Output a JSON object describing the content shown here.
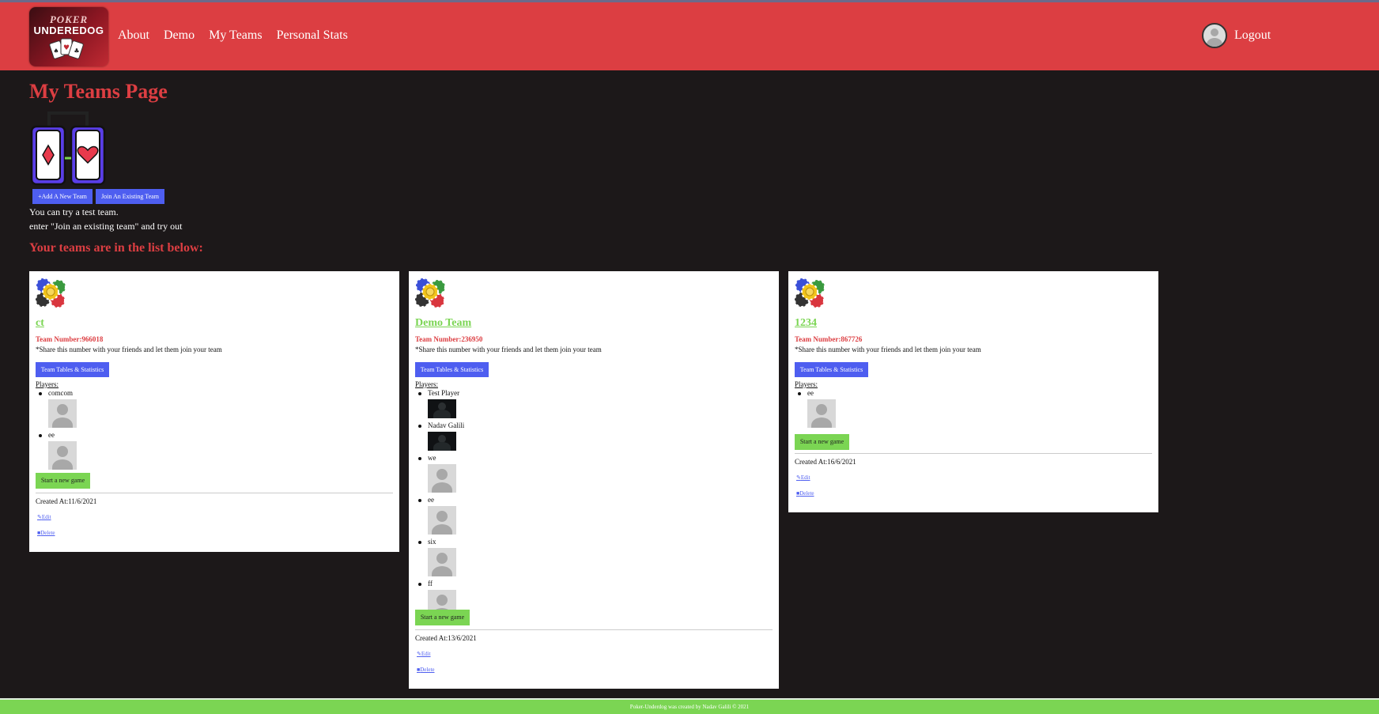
{
  "nav": {
    "logo_line1": "POKER",
    "logo_line2": "UNDEREDOG",
    "links": [
      "About",
      "Demo",
      "My Teams",
      "Personal Stats"
    ],
    "logout": "Logout"
  },
  "page": {
    "title": "My Teams Page",
    "add_team": "+Add A New Team",
    "join_team": "Join An Existing Team",
    "info_line1": "You can try a test team.",
    "info_line2": "enter \"Join an existing team\" and try out",
    "subtitle": "Your teams are in the list below:"
  },
  "common": {
    "share_text": "*Share this number with your friends and let them join your team",
    "stats_button": "Team Tables & Statistics",
    "players_label": "Players:",
    "start_game": "Start a new game",
    "edit": "Edit",
    "delete": "Delete"
  },
  "teams": [
    {
      "name": "ct",
      "number": "Team Number:966018",
      "created": "Created At:11/6/2021",
      "players": [
        {
          "name": "comcom",
          "image": "default-avatar"
        },
        {
          "name": "ee",
          "image": "default-avatar"
        }
      ]
    },
    {
      "name": "Demo Team",
      "number": "Team Number:236950",
      "created": "Created At:13/6/2021",
      "players": [
        {
          "name": "Test Player",
          "image": "photo"
        },
        {
          "name": "Nadav Galili",
          "image": "photo"
        },
        {
          "name": "we",
          "image": "default-avatar"
        },
        {
          "name": "ee",
          "image": "default-avatar"
        },
        {
          "name": "six",
          "image": "default-avatar"
        },
        {
          "name": "ff",
          "image": "default-avatar"
        }
      ]
    },
    {
      "name": "1234",
      "number": "Team Number:867726",
      "created": "Created At:16/6/2021",
      "players": [
        {
          "name": "ee",
          "image": "default-avatar"
        }
      ]
    }
  ],
  "footer": "Poker-Underdog was created by Nadav Galili © 2021",
  "colors": {
    "navbar": "#dc3e42",
    "background": "#1c1819",
    "accent_blue": "#4e5ef0",
    "accent_green": "#7bd553",
    "title_red": "#dc3e42"
  }
}
